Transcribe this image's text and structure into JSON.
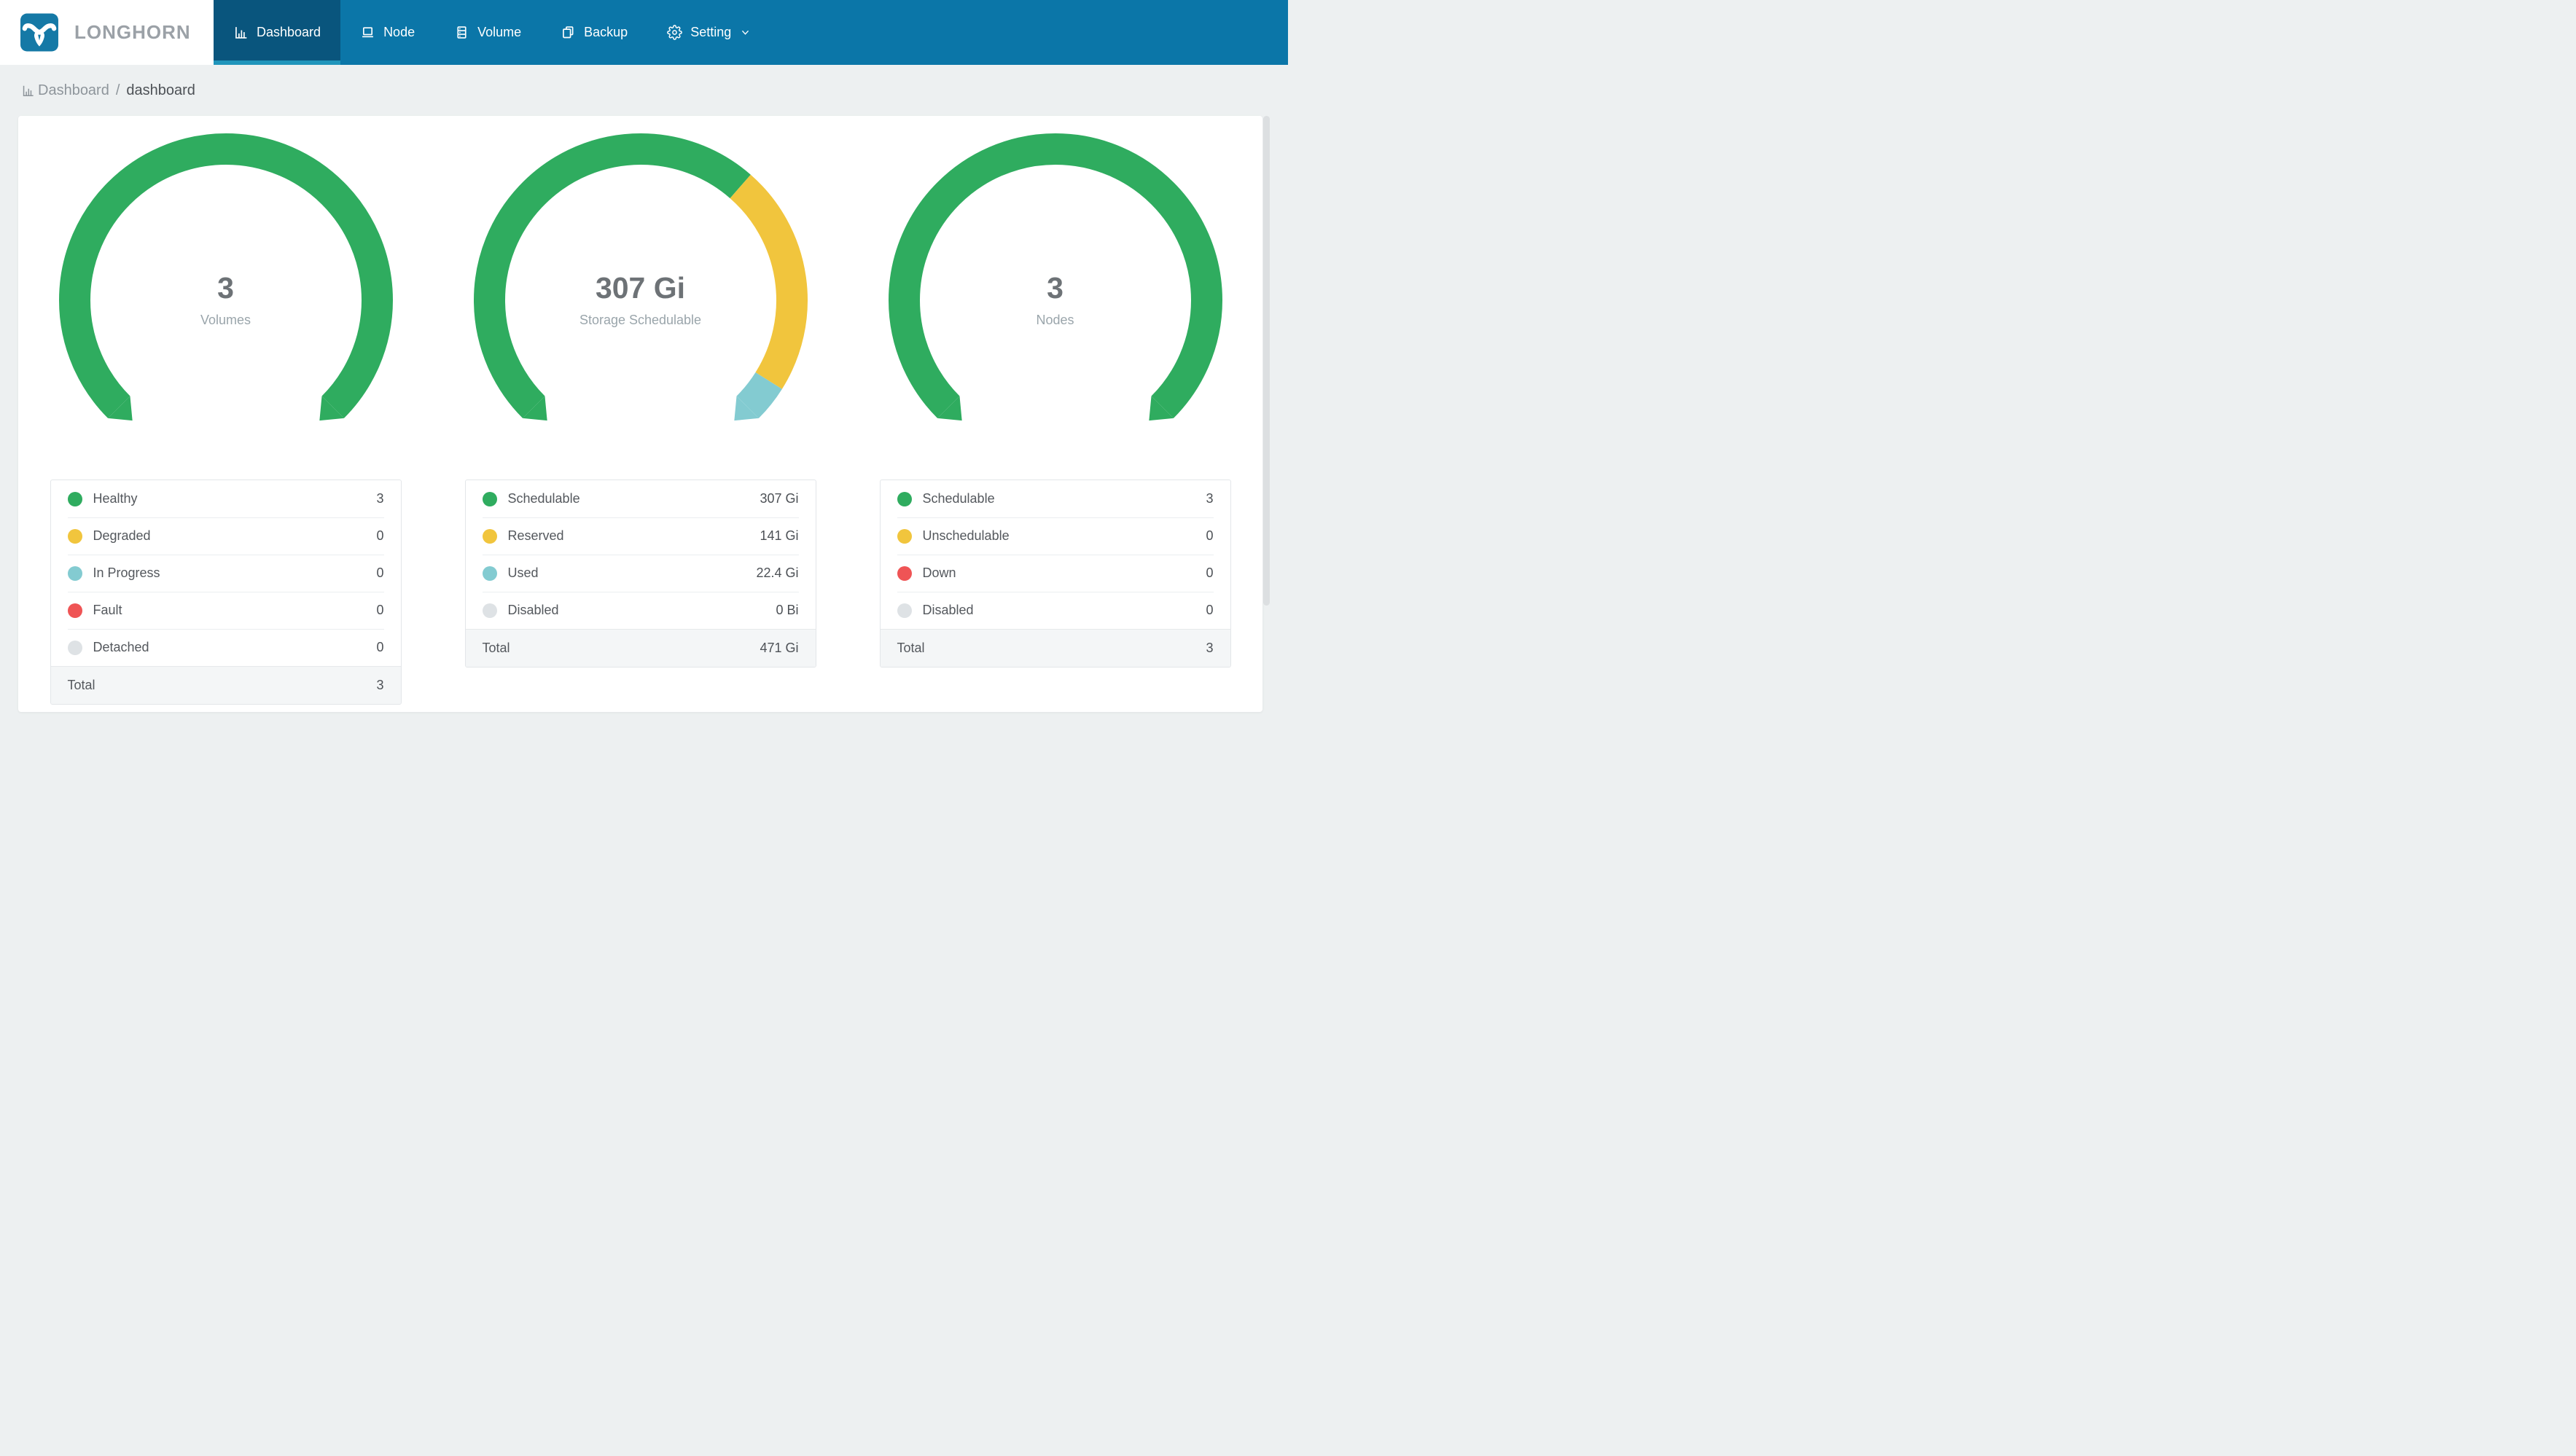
{
  "nav": {
    "brand": "LONGHORN",
    "tabs": [
      {
        "label": "Dashboard",
        "icon": "bar-chart-icon",
        "active": true
      },
      {
        "label": "Node",
        "icon": "laptop-icon",
        "active": false
      },
      {
        "label": "Volume",
        "icon": "server-icon",
        "active": false
      },
      {
        "label": "Backup",
        "icon": "copy-icon",
        "active": false
      },
      {
        "label": "Setting",
        "icon": "gear-icon",
        "active": false,
        "has_dropdown": true
      }
    ]
  },
  "breadcrumb": {
    "section": "Dashboard",
    "separator": "/",
    "page": "dashboard"
  },
  "panels": [
    {
      "name": "volumes",
      "center_value": "3",
      "center_label": "Volumes",
      "legend": [
        {
          "label": "Healthy",
          "value": "3",
          "color": "green"
        },
        {
          "label": "Degraded",
          "value": "0",
          "color": "yellow"
        },
        {
          "label": "In Progress",
          "value": "0",
          "color": "teal"
        },
        {
          "label": "Fault",
          "value": "0",
          "color": "red"
        },
        {
          "label": "Detached",
          "value": "0",
          "color": "gray"
        }
      ],
      "segment_values": [
        3,
        0,
        0,
        0,
        0
      ],
      "total_label": "Total",
      "total_value": "3"
    },
    {
      "name": "storage-schedulable",
      "center_value": "307 Gi",
      "center_label": "Storage Schedulable",
      "legend": [
        {
          "label": "Schedulable",
          "value": "307 Gi",
          "color": "green"
        },
        {
          "label": "Reserved",
          "value": "141 Gi",
          "color": "yellow"
        },
        {
          "label": "Used",
          "value": "22.4 Gi",
          "color": "teal"
        },
        {
          "label": "Disabled",
          "value": "0 Bi",
          "color": "gray"
        }
      ],
      "segment_values": [
        307,
        141,
        22.4,
        0
      ],
      "total_label": "Total",
      "total_value": "471 Gi"
    },
    {
      "name": "nodes",
      "center_value": "3",
      "center_label": "Nodes",
      "legend": [
        {
          "label": "Schedulable",
          "value": "3",
          "color": "green"
        },
        {
          "label": "Unschedulable",
          "value": "0",
          "color": "yellow"
        },
        {
          "label": "Down",
          "value": "0",
          "color": "red"
        },
        {
          "label": "Disabled",
          "value": "0",
          "color": "gray"
        }
      ],
      "segment_values": [
        3,
        0,
        0,
        0
      ],
      "total_label": "Total",
      "total_value": "3"
    }
  ],
  "chart_data": [
    {
      "type": "donut-gauge",
      "title": "Volumes",
      "center_value": "3",
      "categories": [
        "Healthy",
        "Degraded",
        "In Progress",
        "Fault",
        "Detached"
      ],
      "values": [
        3,
        0,
        0,
        0,
        0
      ],
      "total": 3,
      "colors": [
        "#2FAC5F",
        "#F1C53D",
        "#83CBD1",
        "#EF5455",
        "#DEE2E5"
      ],
      "arc": {
        "start_deg": 135,
        "sweep_deg": 270,
        "gap_position": "bottom"
      }
    },
    {
      "type": "donut-gauge",
      "title": "Storage Schedulable",
      "center_value": "307 Gi",
      "categories": [
        "Schedulable",
        "Reserved",
        "Used",
        "Disabled"
      ],
      "values_gi": [
        307,
        141,
        22.4,
        0
      ],
      "total_label": "471 Gi",
      "colors": [
        "#2FAC5F",
        "#F1C53D",
        "#83CBD1",
        "#DEE2E5"
      ],
      "arc": {
        "start_deg": 135,
        "sweep_deg": 270,
        "gap_position": "bottom"
      }
    },
    {
      "type": "donut-gauge",
      "title": "Nodes",
      "center_value": "3",
      "categories": [
        "Schedulable",
        "Unschedulable",
        "Down",
        "Disabled"
      ],
      "values": [
        3,
        0,
        0,
        0
      ],
      "total": 3,
      "colors": [
        "#2FAC5F",
        "#F1C53D",
        "#EF5455",
        "#DEE2E5"
      ],
      "arc": {
        "start_deg": 135,
        "sweep_deg": 270,
        "gap_position": "bottom"
      }
    }
  ],
  "colors": {
    "green": "#2FAC5F",
    "yellow": "#F1C53D",
    "teal": "#83CBD1",
    "red": "#EF5455",
    "gray": "#DEE2E5",
    "nav_bg": "#0B76A8",
    "nav_active_bg": "#09557D",
    "nav_active_indicator": "#2095BB",
    "brand_text": "#9BA1A7",
    "page_bg": "#EDF0F1",
    "card_bg": "#FFFFFF",
    "center_value_text": "#6D7276",
    "center_label_text": "#9AA5AB",
    "row_text": "#54585D",
    "total_row_bg": "#F4F6F7"
  }
}
